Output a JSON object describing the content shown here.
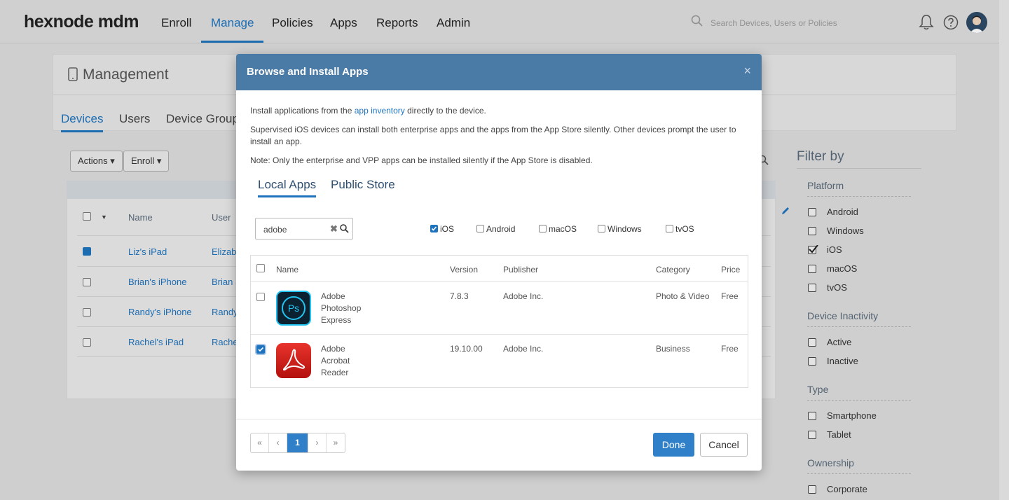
{
  "topnav": {
    "logo": "hexnode mdm",
    "items": [
      "Enroll",
      "Manage",
      "Policies",
      "Apps",
      "Reports",
      "Admin"
    ],
    "active": "Manage",
    "search_placeholder": "Search Devices, Users or Policies"
  },
  "page": {
    "title": "Management",
    "subtabs": [
      "Devices",
      "Users",
      "Device Group"
    ],
    "actions_label": "Actions",
    "enroll_label": "Enroll",
    "columns": [
      "Name",
      "User"
    ],
    "rows": [
      {
        "name": "Liz's iPad",
        "user": "Elizabe",
        "checked": true
      },
      {
        "name": "Brian's iPhone",
        "user": "Brian S",
        "checked": false
      },
      {
        "name": "Randy's iPhone",
        "user": "Randy",
        "checked": false
      },
      {
        "name": "Rachel's iPad",
        "user": "Rachel",
        "checked": false
      }
    ]
  },
  "filter": {
    "title": "Filter by",
    "groups": [
      {
        "label": "Platform",
        "items": [
          "Android",
          "Windows",
          "iOS",
          "macOS",
          "tvOS"
        ],
        "checked": [
          "iOS"
        ]
      },
      {
        "label": "Device Inactivity",
        "items": [
          "Active",
          "Inactive"
        ]
      },
      {
        "label": "Type",
        "items": [
          "Smartphone",
          "Tablet"
        ]
      },
      {
        "label": "Ownership",
        "items": [
          "Corporate"
        ]
      }
    ]
  },
  "modal": {
    "title": "Browse and Install Apps",
    "close": "×",
    "info1_pre": "Install applications from the ",
    "info1_link": "app inventory",
    "info1_post": " directly to the device.",
    "info2": "Supervised iOS devices can install both enterprise apps and the apps from the App Store silently. Other devices prompt the user to install an app.",
    "info3": "Note: Only the enterprise and VPP apps can be installed silently if the App Store is disabled.",
    "tabs": [
      "Local Apps",
      "Public Store"
    ],
    "search_value": "adobe",
    "platforms": [
      {
        "label": "iOS",
        "checked": true
      },
      {
        "label": "Android",
        "checked": false
      },
      {
        "label": "macOS",
        "checked": false
      },
      {
        "label": "Windows",
        "checked": false
      },
      {
        "label": "tvOS",
        "checked": false
      }
    ],
    "columns": [
      "Name",
      "Version",
      "Publisher",
      "Category",
      "Price"
    ],
    "apps": [
      {
        "name_lines": [
          "Adobe",
          "Photoshop",
          "Express"
        ],
        "version": "7.8.3",
        "publisher": "Adobe Inc.",
        "category": "Photo & Video",
        "price": "Free",
        "checked": false,
        "icon": "photoshop-express-icon",
        "icon_text": "Ps"
      },
      {
        "name_lines": [
          "Adobe",
          "Acrobat",
          "Reader"
        ],
        "version": "19.10.00",
        "publisher": "Adobe Inc.",
        "category": "Business",
        "price": "Free",
        "checked": true,
        "icon": "acrobat-reader-icon"
      }
    ],
    "pager": {
      "first": "«",
      "prev": "‹",
      "current": "1",
      "next": "›",
      "last": "»"
    },
    "done": "Done",
    "cancel": "Cancel"
  },
  "colors": {
    "accent": "#1e73be",
    "header": "#4a7aa6"
  }
}
